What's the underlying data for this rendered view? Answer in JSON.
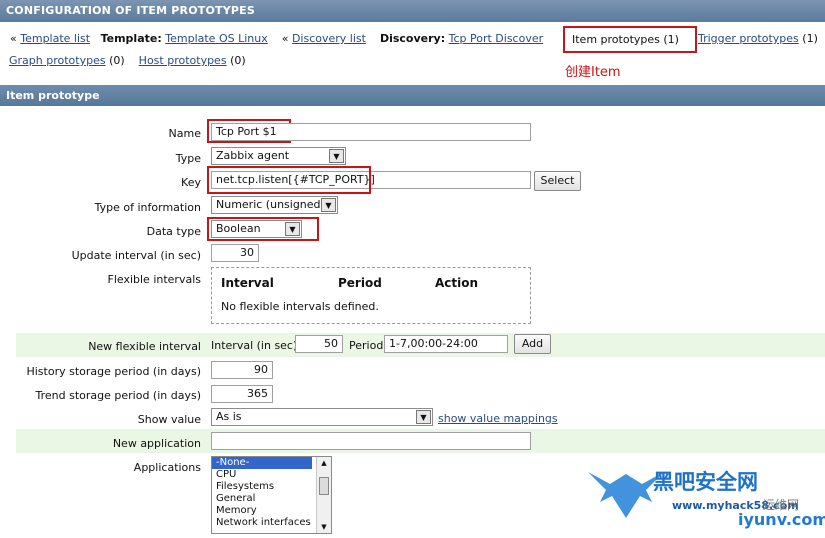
{
  "header": {
    "title": "CONFIGURATION OF ITEM PROTOTYPES"
  },
  "nav": {
    "template_list": "Template list",
    "template_label": "Template:",
    "template_name": "Template OS Linux",
    "discovery_list": "Discovery list",
    "discovery_label": "Discovery:",
    "discovery_name": "Tcp Port Discover",
    "item_prototypes": "Item prototypes",
    "item_prototypes_count": "(1)",
    "trigger_prototypes": "Trigger prototypes",
    "trigger_prototypes_count": "(1)",
    "graph_prototypes": "Graph prototypes",
    "graph_prototypes_count": "(0)",
    "host_prototypes": "Host prototypes",
    "host_prototypes_count": "(0)",
    "arrow": "«"
  },
  "annotation": "创建Item",
  "section_title": "Item prototype",
  "form": {
    "name_label": "Name",
    "name_value": "Tcp Port $1",
    "type_label": "Type",
    "type_value": "Zabbix agent",
    "key_label": "Key",
    "key_value": "net.tcp.listen[{#TCP_PORT}]",
    "select_button": "Select",
    "type_info_label": "Type of information",
    "type_info_value": "Numeric (unsigned)",
    "data_type_label": "Data type",
    "data_type_value": "Boolean",
    "update_interval_label": "Update interval (in sec)",
    "update_interval_value": "30",
    "flexible_intervals_label": "Flexible intervals",
    "flex_col_interval": "Interval",
    "flex_col_period": "Period",
    "flex_col_action": "Action",
    "flex_empty": "No flexible intervals defined.",
    "new_flex_label": "New flexible interval",
    "new_flex_interval_label": "Interval (in sec)",
    "new_flex_interval_value": "50",
    "new_flex_period_label": "Period",
    "new_flex_period_value": "1-7,00:00-24:00",
    "add_button": "Add",
    "history_label": "History storage period (in days)",
    "history_value": "90",
    "trend_label": "Trend storage period (in days)",
    "trend_value": "365",
    "show_value_label": "Show value",
    "show_value_value": "As is",
    "show_value_mappings": "show value mappings",
    "new_application_label": "New application",
    "new_application_value": "",
    "applications_label": "Applications",
    "applications": [
      "-None-",
      "CPU",
      "Filesystems",
      "General",
      "Memory",
      "Network interfaces"
    ]
  },
  "watermark": {
    "brand": "黑吧安全网",
    "url": "www.myhack58.com",
    "site2": "运维网",
    "site2_url": "iyunv.com"
  },
  "colors": {
    "highlight_red": "#c81616",
    "link_blue": "#2b4a85",
    "header_bg": "#6b88aa",
    "green_row": "#eaf7e4"
  }
}
